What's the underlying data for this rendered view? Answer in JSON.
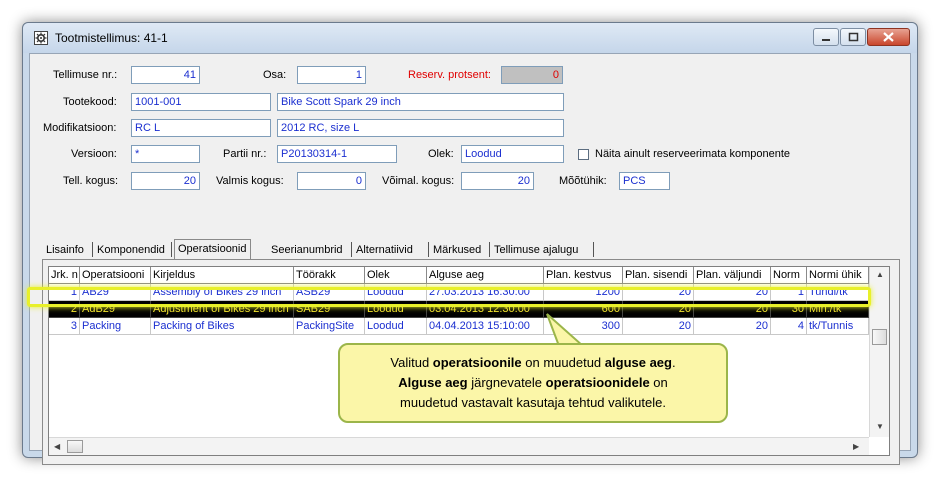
{
  "window": {
    "title": "Tootmistellimus: 41-1"
  },
  "form": {
    "tellimuse_nr_label": "Tellimuse nr.:",
    "tellimuse_nr_value": "41",
    "osa_label": "Osa:",
    "osa_value": "1",
    "reserv_label": "Reserv. protsent:",
    "reserv_value": "0",
    "tootekood_label": "Tootekood:",
    "tootekood_value": "1001-001",
    "tootekood_name": "Bike Scott Spark 29 inch",
    "modifikatsioon_label": "Modifikatsioon:",
    "modifikatsioon_value": "RC L",
    "modifikatsioon_name": "2012 RC, size L",
    "versioon_label": "Versioon:",
    "versioon_value": "*",
    "partii_label": "Partii nr.:",
    "partii_value": "P20130314-1",
    "olek_label": "Olek:",
    "olek_value": "Loodud",
    "checkbox_label": "Näita ainult reserveerimata komponente",
    "tell_kogus_label": "Tell. kogus:",
    "tell_kogus_value": "20",
    "valmis_kogus_label": "Valmis kogus:",
    "valmis_kogus_value": "0",
    "voimal_kogus_label": "Võimal. kogus:",
    "voimal_kogus_value": "20",
    "mootuhik_label": "Mõõtühik:",
    "mootuhik_value": "PCS"
  },
  "tabs": [
    "Lisainfo",
    "Komponendid",
    "Operatsioonid",
    "Seerianumbrid",
    "Alternatiivid",
    "Märkused",
    "Tellimuse ajalugu"
  ],
  "active_tab": "Operatsioonid",
  "table": {
    "columns": [
      "Jrk. n",
      "Operatsiooni",
      "Kirjeldus",
      "Töörakk",
      "Olek",
      "Alguse aeg",
      "Plan. kestvus",
      "Plan. sisendi",
      "Plan. väljundi",
      "Norm",
      "Normi ühik"
    ],
    "rows": [
      [
        "1",
        "AB29",
        "Assembly of Bikes 29 inch",
        "ASB29",
        "Loodud",
        "27.03.2013 16:30:00",
        "1200",
        "20",
        "20",
        "1",
        "Tundi/tk"
      ],
      [
        "2",
        "AdB29",
        "Adjustment of Bikes 29 inch",
        "SAB29",
        "Loodud",
        "03.04.2013 12:30:00",
        "600",
        "20",
        "20",
        "30",
        "Min./tk"
      ],
      [
        "3",
        "Packing",
        "Packing of Bikes",
        "PackingSite",
        "Loodud",
        "04.04.2013 15:10:00",
        "300",
        "20",
        "20",
        "4",
        "tk/Tunnis"
      ]
    ],
    "selected_row": 1
  },
  "callout": {
    "l1_a": "Valitud ",
    "l1_b": "operatsioonile",
    "l1_c": " on muudetud ",
    "l1_d": "alguse aeg",
    "l1_e": ".",
    "l2_a": "Alguse aeg",
    "l2_b": " järgnevatele ",
    "l2_c": "operatsioonidele",
    "l2_d": " on",
    "l3": "muudetud vastavalt kasutaja tehtud valikutele."
  },
  "icons": [
    "app-gear-icon",
    "minimize-icon",
    "maximize-icon",
    "close-icon",
    "scroll-up-icon",
    "scroll-down-icon",
    "scroll-left-icon",
    "scroll-right-icon"
  ],
  "colors": {
    "value_text": "#1b2fd0",
    "label_red": "#e00000",
    "highlight": "#e8f02a",
    "callout_bg": "#fbf6a8"
  }
}
